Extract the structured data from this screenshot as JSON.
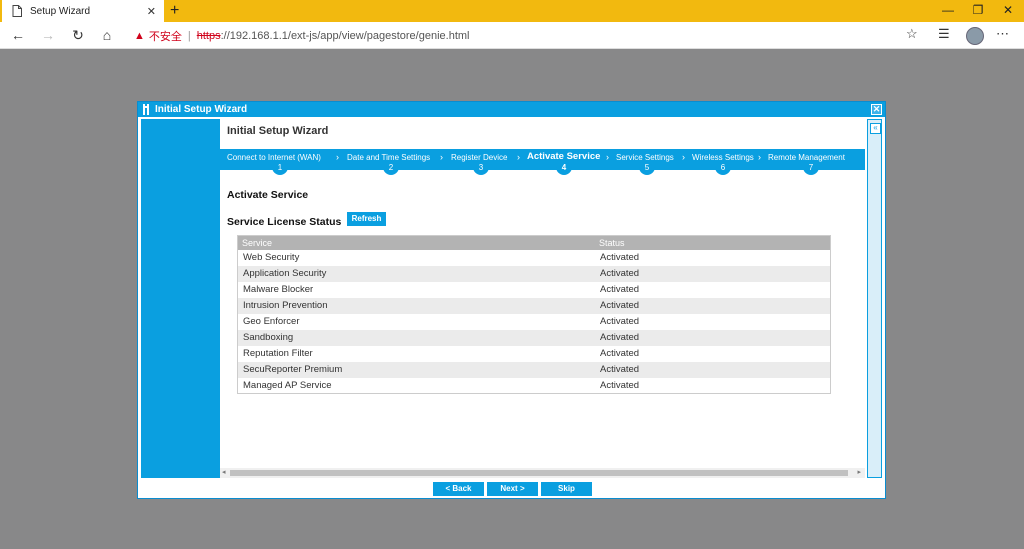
{
  "browser": {
    "tab_title": "Setup Wizard",
    "new_tab_label": "+",
    "security_label": "不安全",
    "url_protocol": "https",
    "url_rest": "://192.168.1.1/ext-js/app/view/pagestore/genie.html"
  },
  "dialog": {
    "title": "Initial Setup Wizard",
    "wizard_title": "Initial Setup Wizard",
    "steps": [
      {
        "label": "Connect to Internet (WAN)",
        "num": "1"
      },
      {
        "label": "Date and Time Settings",
        "num": "2"
      },
      {
        "label": "Register Device",
        "num": "3"
      },
      {
        "label": "Activate Service",
        "num": "4"
      },
      {
        "label": "Service Settings",
        "num": "5"
      },
      {
        "label": "Wireless Settings",
        "num": "6"
      },
      {
        "label": "Remote Management",
        "num": "7"
      }
    ],
    "section_title": "Activate Service",
    "license_title": "Service License Status",
    "refresh_label": "Refresh",
    "table": {
      "headers": [
        "Service",
        "Status"
      ],
      "rows": [
        [
          "Web Security",
          "Activated"
        ],
        [
          "Application Security",
          "Activated"
        ],
        [
          "Malware Blocker",
          "Activated"
        ],
        [
          "Intrusion Prevention",
          "Activated"
        ],
        [
          "Geo Enforcer",
          "Activated"
        ],
        [
          "Sandboxing",
          "Activated"
        ],
        [
          "Reputation Filter",
          "Activated"
        ],
        [
          "SecuReporter Premium",
          "Activated"
        ],
        [
          "Managed AP Service",
          "Activated"
        ]
      ]
    },
    "buttons": {
      "back": "< Back",
      "next": "Next >",
      "skip": "Skip"
    }
  },
  "colors": {
    "accent": "#0a9fe0",
    "tabbar": "#f2b90f",
    "background": "#888889"
  }
}
